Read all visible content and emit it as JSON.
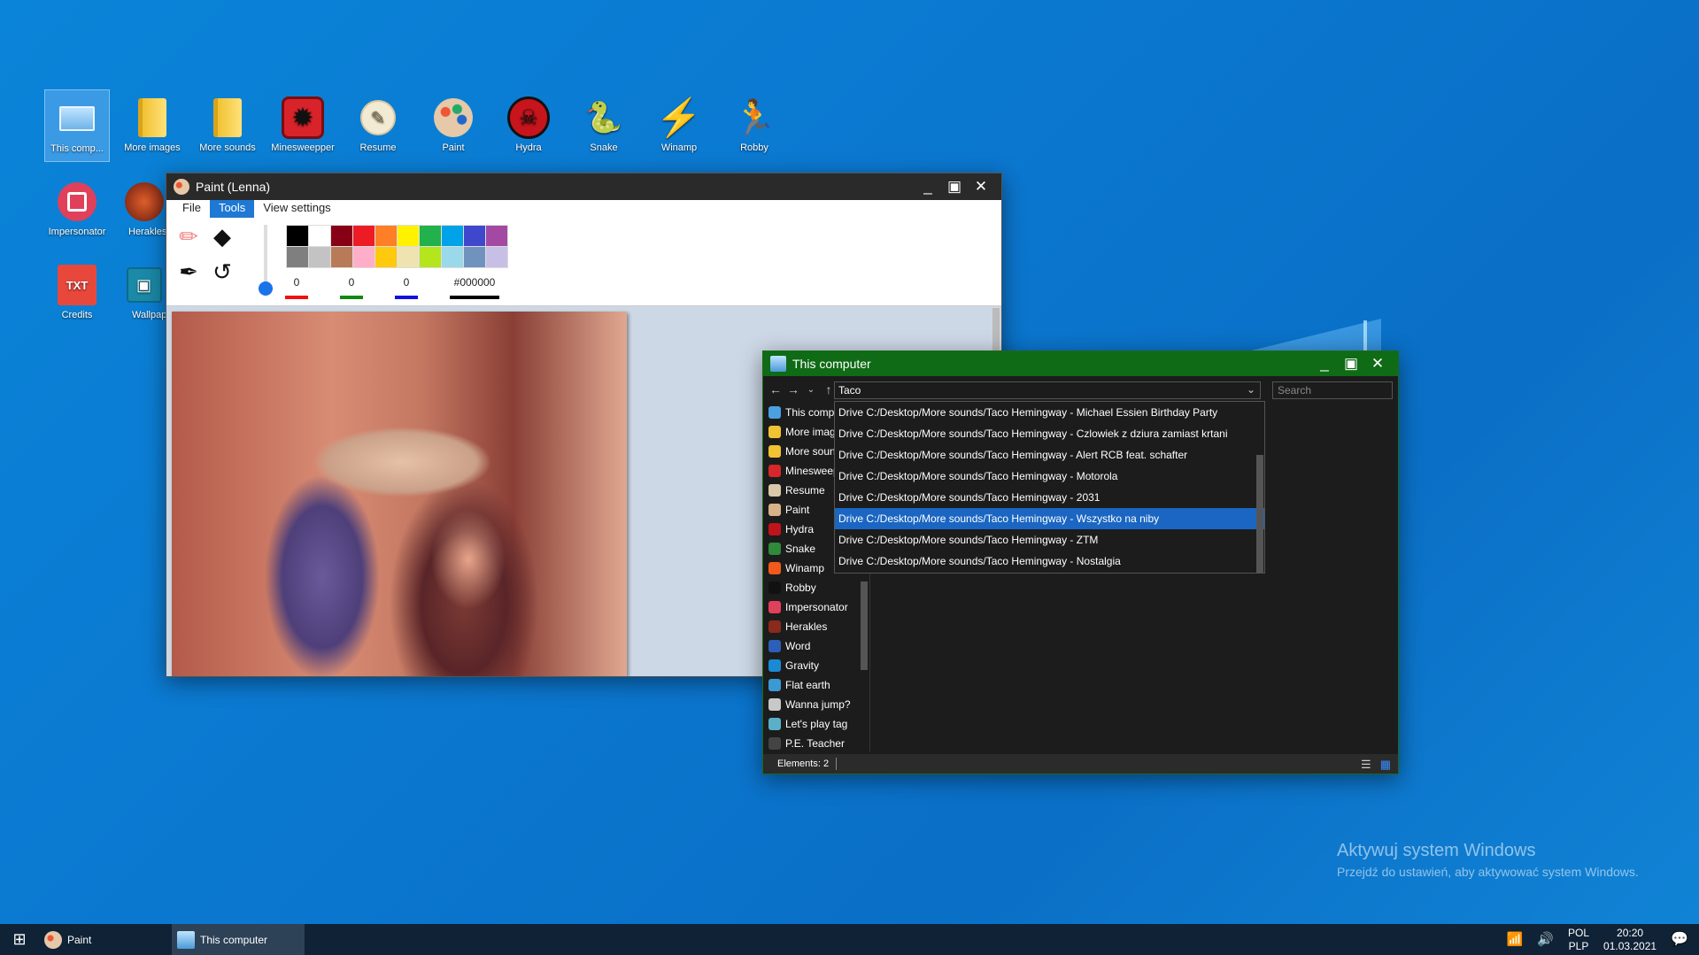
{
  "desktop": {
    "icons": [
      {
        "label": "This comp...",
        "icon": "computer-icon"
      },
      {
        "label": "More images",
        "icon": "folder-icon"
      },
      {
        "label": "More sounds",
        "icon": "folder-icon"
      },
      {
        "label": "Minesweepper",
        "icon": "mine-icon"
      },
      {
        "label": "Resume",
        "icon": "resume-icon"
      },
      {
        "label": "Paint",
        "icon": "palette-icon"
      },
      {
        "label": "Hydra",
        "icon": "hydra-icon"
      },
      {
        "label": "Snake",
        "icon": "snake-icon"
      },
      {
        "label": "Winamp",
        "icon": "winamp-icon"
      },
      {
        "label": "Robby",
        "icon": "runner-icon"
      },
      {
        "label": "Impersonator",
        "icon": "stop-icon"
      },
      {
        "label": "Herakles",
        "icon": "herakles-icon"
      },
      {
        "label": "Credits",
        "icon": "txt-file-icon",
        "badge": "TXT"
      },
      {
        "label": "Wallpap",
        "icon": "image-icon"
      }
    ]
  },
  "paint": {
    "title": "Paint (Lenna)",
    "menu": [
      "File",
      "Tools",
      "View settings"
    ],
    "active_menu": "Tools",
    "red_value": "0",
    "green_value": "0",
    "blue_value": "0",
    "hex_value": "#000000",
    "palette": [
      "#000000",
      "#ffffff",
      "#880015",
      "#ed1c24",
      "#ff7f27",
      "#fff200",
      "#22b14c",
      "#00a2e8",
      "#3f48cc",
      "#a349a4",
      "#7f7f7f",
      "#c3c3c3",
      "#b97a57",
      "#ffaec9",
      "#ffc90e",
      "#efe4b0",
      "#b5e61d",
      "#99d9ea",
      "#7092be",
      "#c8bfe7"
    ]
  },
  "explorer": {
    "title": "This computer",
    "address_value": "Taco",
    "search_placeholder": "Search",
    "sidebar": [
      {
        "label": "This comp",
        "color": "#4aa0e0"
      },
      {
        "label": "More imag",
        "color": "#f1c232"
      },
      {
        "label": "More soun",
        "color": "#f1c232"
      },
      {
        "label": "Minesweep",
        "color": "#d62828"
      },
      {
        "label": "Resume",
        "color": "#d9c9a8"
      },
      {
        "label": "Paint",
        "color": "#d9b28a"
      },
      {
        "label": "Hydra",
        "color": "#c0141c"
      },
      {
        "label": "Snake",
        "color": "#2f8a3a"
      },
      {
        "label": "Winamp",
        "color": "#f05a1a"
      },
      {
        "label": "Robby",
        "color": "#111111"
      },
      {
        "label": "Impersonator",
        "color": "#e0405a"
      },
      {
        "label": "Herakles",
        "color": "#8a2a1a"
      },
      {
        "label": "Word",
        "color": "#2b5fb8"
      },
      {
        "label": "Gravity",
        "color": "#1a8ad4"
      },
      {
        "label": "Flat earth",
        "color": "#3a9ad4"
      },
      {
        "label": "Wanna jump?",
        "color": "#c8c8c8"
      },
      {
        "label": "Let's play tag",
        "color": "#5ab0c8"
      },
      {
        "label": "P.E. Teacher",
        "color": "#444444"
      }
    ],
    "suggestions": [
      "Drive C:/Desktop/More sounds/Taco Hemingway - Michael Essien Birthday Party",
      "Drive C:/Desktop/More sounds/Taco Hemingway - Czlowiek z dziura zamiast krtani",
      "Drive C:/Desktop/More sounds/Taco Hemingway - Alert RCB feat. schafter",
      "Drive C:/Desktop/More sounds/Taco Hemingway - Motorola",
      "Drive C:/Desktop/More sounds/Taco Hemingway - 2031",
      "Drive C:/Desktop/More sounds/Taco Hemingway - Wszystko na niby",
      "Drive C:/Desktop/More sounds/Taco Hemingway - ZTM",
      "Drive C:/Desktop/More sounds/Taco Hemingway - Nostalgia"
    ],
    "selected_suggestion": "Drive C:/Desktop/More sounds/Taco Hemingway - Wszystko na niby",
    "status": "Elements: 2"
  },
  "watermark": {
    "line1": "Aktywuj system Windows",
    "line2": "Przejdź do ustawień, aby aktywować system Windows."
  },
  "taskbar": {
    "items": [
      {
        "label": "Paint",
        "active": false
      },
      {
        "label": "This computer",
        "active": true
      }
    ],
    "lang_top": "POL",
    "lang_bottom": "PLP",
    "time": "20:20",
    "date": "01.03.2021"
  }
}
